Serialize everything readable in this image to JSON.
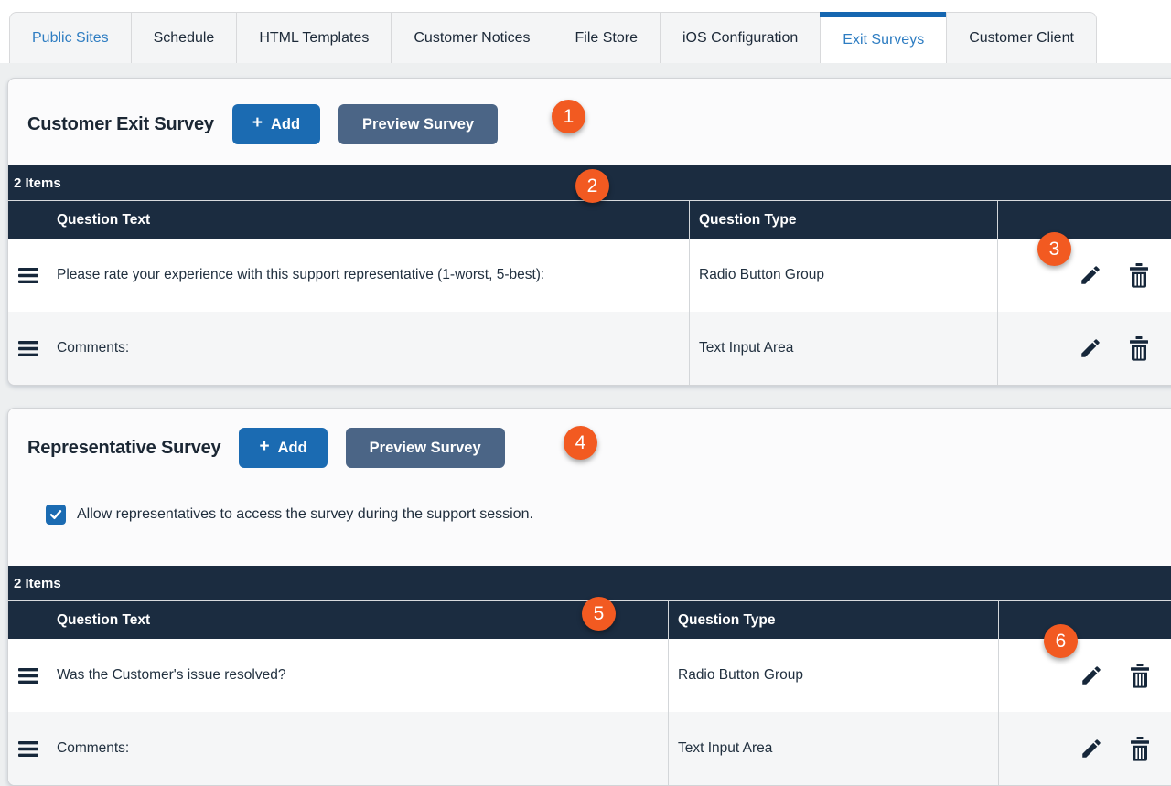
{
  "tabs": [
    {
      "label": "Public Sites"
    },
    {
      "label": "Schedule"
    },
    {
      "label": "HTML Templates"
    },
    {
      "label": "Customer Notices"
    },
    {
      "label": "File Store"
    },
    {
      "label": "iOS Configuration"
    },
    {
      "label": "Exit Surveys"
    },
    {
      "label": "Customer Client"
    }
  ],
  "active_tab": "Exit Surveys",
  "sections": [
    {
      "title": "Customer Exit Survey",
      "buttons": {
        "add_plus": "+",
        "add_label": "Add",
        "preview_label": "Preview Survey"
      },
      "items_count": "2 Items",
      "columns": [
        "Question Text",
        "Question Type"
      ],
      "rows": [
        {
          "text": "Please rate your experience with this support representative (1-worst, 5-best):",
          "type": "Radio Button Group"
        },
        {
          "text": "Comments:",
          "type": "Text Input Area"
        }
      ]
    },
    {
      "title": "Representative Survey",
      "buttons": {
        "add_plus": "+",
        "add_label": "Add",
        "preview_label": "Preview Survey"
      },
      "checkbox": {
        "label": "Allow representatives to access the survey during the support session.",
        "checked": true
      },
      "items_count": "2 Items",
      "columns": [
        "Question Text",
        "Question Type"
      ],
      "rows": [
        {
          "text": "Was the Customer's issue resolved?",
          "type": "Radio Button Group"
        },
        {
          "text": "Comments:",
          "type": "Text Input Area"
        }
      ]
    }
  ],
  "callouts": [
    "1",
    "2",
    "3",
    "4",
    "5",
    "6"
  ],
  "colors": {
    "primary_blue": "#1b6bb2",
    "slate_blue": "#4b6586",
    "navy_header": "#1b2c40",
    "callout_orange": "#f25a21",
    "active_tab_bar": "#1566b0",
    "link_blue": "#2e7dc2"
  }
}
